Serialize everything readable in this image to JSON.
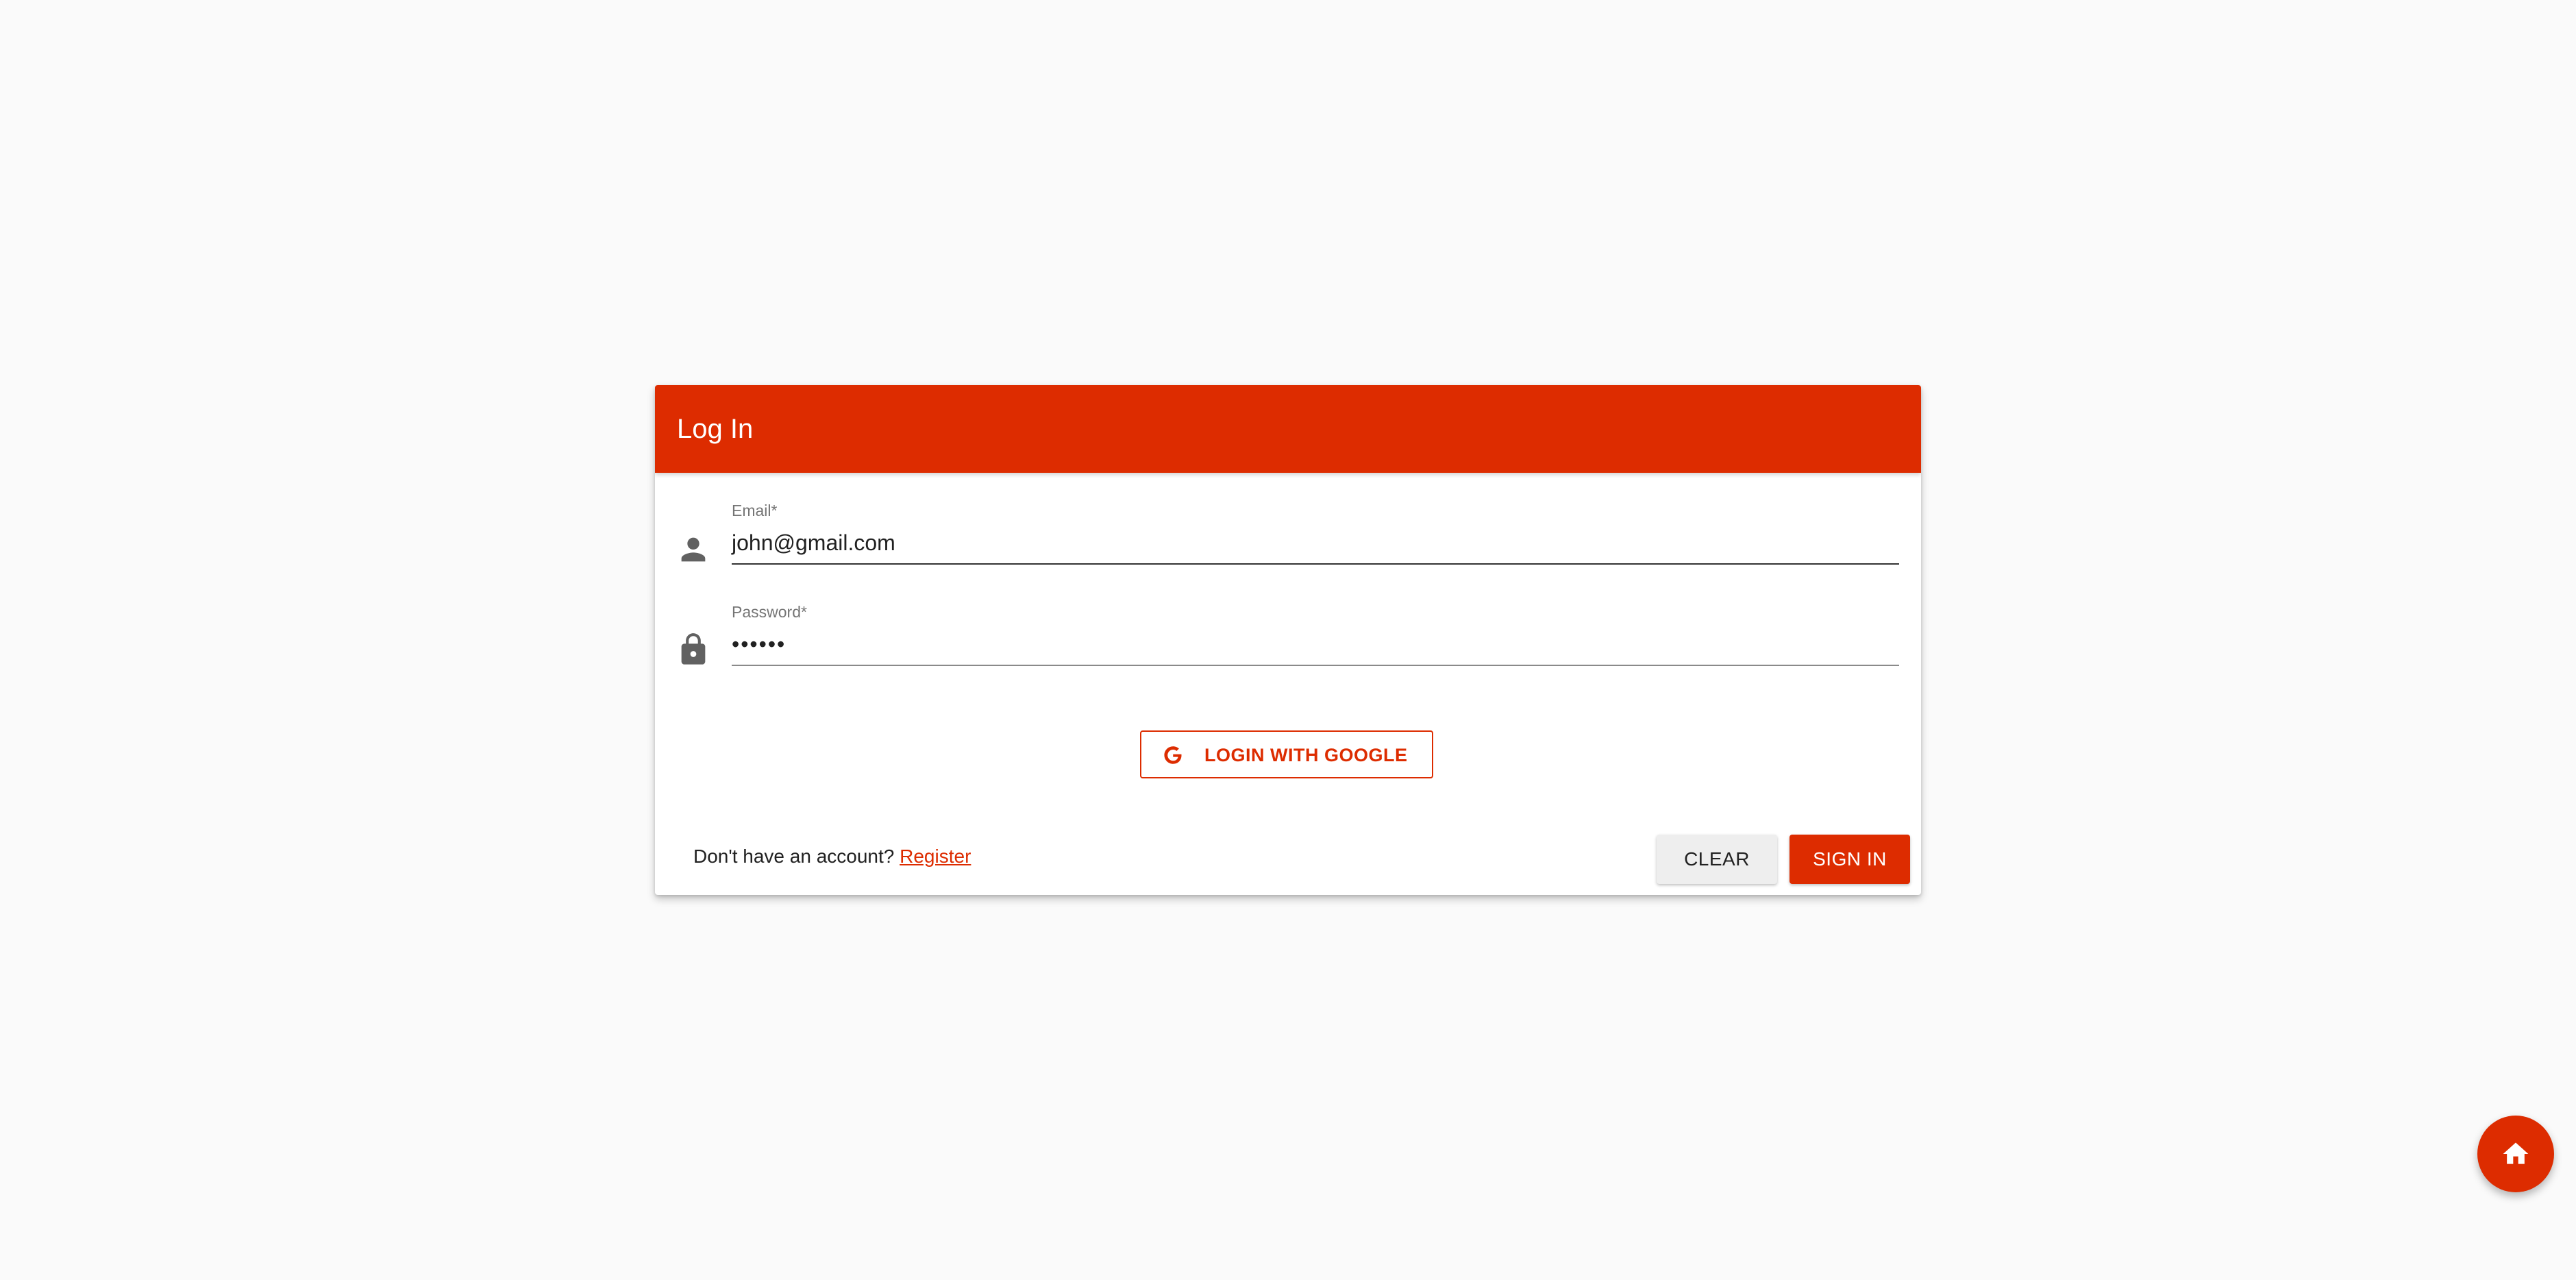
{
  "dialog": {
    "title": "Log In"
  },
  "email": {
    "label": "Email*",
    "value": "john@gmail.com",
    "icon": "person-icon"
  },
  "password": {
    "label": "Password*",
    "value": "••••••",
    "icon": "lock-icon"
  },
  "google_button": {
    "label": "LOGIN WITH GOOGLE",
    "icon": "google-icon"
  },
  "footer": {
    "prompt": "Don't have an account?",
    "register_label": "Register"
  },
  "actions": {
    "clear_label": "CLEAR",
    "signin_label": "SIGN IN"
  },
  "fab": {
    "icon": "home-icon"
  },
  "colors": {
    "accent": "#dd2c00",
    "background": "#fafafa"
  }
}
